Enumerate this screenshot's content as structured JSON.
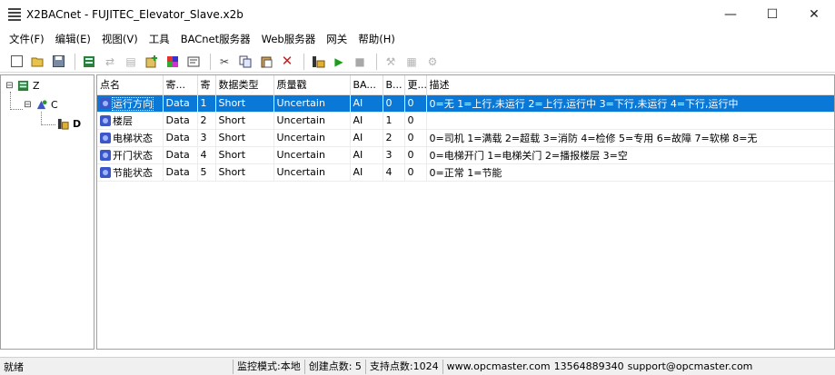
{
  "window": {
    "title": "X2BACnet - FUJITEC_Elevator_Slave.x2b",
    "minimize": "—",
    "maximize": "☐",
    "close": "✕"
  },
  "menu": [
    "文件(F)",
    "编辑(E)",
    "视图(V)",
    "工具",
    "BACnet服务器",
    "Web服务器",
    "网关",
    "帮助(H)"
  ],
  "toolbar": {
    "icons": [
      "new-file-icon",
      "open-folder-icon",
      "save-icon",
      "device-icon",
      "disabled-icon",
      "disabled-icon",
      "add-icon",
      "color-icon",
      "properties-icon",
      "cut-icon",
      "copy-icon",
      "paste-icon",
      "delete-icon",
      "monitor-icon",
      "run-icon",
      "stop-icon",
      "disabled-icon",
      "disabled-icon",
      "disabled-icon"
    ]
  },
  "tree": {
    "root": "Z",
    "child": "C",
    "leaf": "D",
    "root_expander": "⊟",
    "child_expander": "⊟"
  },
  "grid": {
    "columns": [
      "点名",
      "寄...",
      "寄",
      "数据类型",
      "质量戳",
      "BA...",
      "B...",
      "更...",
      "描述"
    ],
    "rows": [
      {
        "name": "运行方向",
        "reg_type": "Data",
        "reg": "1",
        "dtype": "Short",
        "quality": "Uncertain",
        "ba": "AI",
        "b": "0",
        "upd": "0",
        "desc": "0=无 1=上行,未运行 2=上行,运行中 3=下行,未运行 4=下行,运行中"
      },
      {
        "name": "楼层",
        "reg_type": "Data",
        "reg": "2",
        "dtype": "Short",
        "quality": "Uncertain",
        "ba": "AI",
        "b": "1",
        "upd": "0",
        "desc": ""
      },
      {
        "name": "电梯状态",
        "reg_type": "Data",
        "reg": "3",
        "dtype": "Short",
        "quality": "Uncertain",
        "ba": "AI",
        "b": "2",
        "upd": "0",
        "desc": "0=司机 1=满载 2=超载 3=消防 4=检修 5=专用 6=故障 7=软梯 8=无"
      },
      {
        "name": "开门状态",
        "reg_type": "Data",
        "reg": "4",
        "dtype": "Short",
        "quality": "Uncertain",
        "ba": "AI",
        "b": "3",
        "upd": "0",
        "desc": "0=电梯开门 1=电梯关门 2=播报楼层 3=空"
      },
      {
        "name": "节能状态",
        "reg_type": "Data",
        "reg": "5",
        "dtype": "Short",
        "quality": "Uncertain",
        "ba": "AI",
        "b": "4",
        "upd": "0",
        "desc": "0=正常 1=节能"
      }
    ]
  },
  "status": {
    "ready": "就绪",
    "mode": "监控模式:本地",
    "created": "创建点数: 5",
    "supported": "支持点数:1024",
    "site": "www.opcmaster.com",
    "phone": "13564889340",
    "email": "support@opcmaster.com"
  },
  "colors": {
    "selection": "#0a78d7",
    "run": "#1a9e1a",
    "delete": "#d21a1a",
    "row_icon": "#3b56c7"
  }
}
